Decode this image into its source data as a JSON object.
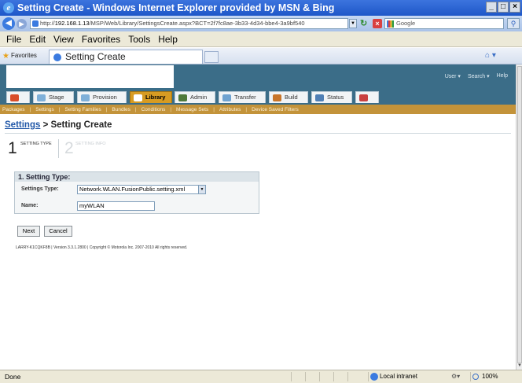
{
  "window": {
    "title": "Setting Create - Windows Internet Explorer provided by MSN & Bing",
    "min": "_",
    "max": "□",
    "close": "×"
  },
  "address": {
    "url_prefix": "http://",
    "url_host": "192.168.1.13",
    "url_path": "/MSP/Web/Library/SettingsCreate.aspx?BCT=2f7fc8ae-3b33-4d34-bbe4-3a9bf540",
    "search_placeholder": "Google"
  },
  "menu": [
    "File",
    "Edit",
    "View",
    "Favorites",
    "Tools",
    "Help"
  ],
  "favorites": {
    "label": "Favorites",
    "tab_title": "Setting Create"
  },
  "app": {
    "util_nav": [
      "User ▾",
      "Search ▾",
      "Help"
    ],
    "tabs": [
      {
        "label": "",
        "icon": "home-icon",
        "color": "#d94d2a"
      },
      {
        "label": "Stage",
        "icon": "stage-icon",
        "color": "#7fb0d9"
      },
      {
        "label": "Provision",
        "icon": "provision-icon",
        "color": "#7fb0d9"
      },
      {
        "label": "Library",
        "icon": "library-icon",
        "color": "#3b6d88",
        "active": true
      },
      {
        "label": "Admin",
        "icon": "admin-icon",
        "color": "#4f7a3a"
      },
      {
        "label": "Transfer",
        "icon": "transfer-icon",
        "color": "#6fa3d1"
      },
      {
        "label": "Build",
        "icon": "build-icon",
        "color": "#c8752a"
      },
      {
        "label": "Status",
        "icon": "status-icon",
        "color": "#4f7fb5"
      },
      {
        "label": "",
        "icon": "report-icon",
        "color": "#c94040"
      }
    ],
    "subnav": [
      "Packages",
      "Settings",
      "Setting Families",
      "Bundles",
      "Conditions",
      "Message Sets",
      "Attributes",
      "Device Saved Filters"
    ],
    "breadcrumb": {
      "link": "Settings",
      "sep": " > ",
      "current": "Setting Create"
    },
    "steps": [
      {
        "num": "1",
        "label": "SETTING TYPE"
      },
      {
        "num": "2",
        "label": "SETTING INFO"
      }
    ],
    "form": {
      "section_title": "1. Setting Type:",
      "type_label": "Settings Type:",
      "type_value": "Network.WLAN.FusionPublic.setting.xml",
      "name_label": "Name:",
      "name_value": "myWLAN"
    },
    "buttons": {
      "next": "Next",
      "cancel": "Cancel"
    },
    "footer": "LARRY-K1CQKF8B | Version 3.3.1.2800 | Copyright © Motorola Inc. 2007-2010 All rights reserved."
  },
  "statusbar": {
    "status": "Done",
    "zone": "Local intranet",
    "zoom": "100%"
  }
}
